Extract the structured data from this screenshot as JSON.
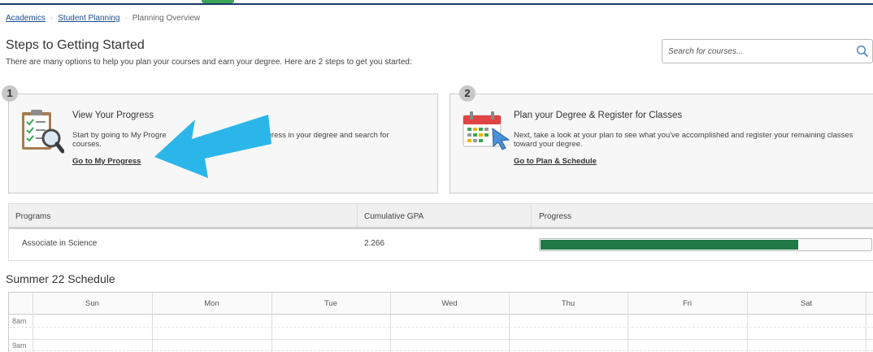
{
  "breadcrumb": {
    "items": [
      "Academics",
      "Student Planning",
      "Planning Overview"
    ]
  },
  "header": {
    "title": "Steps to Getting Started",
    "subtitle": "There are many options to help you plan your courses and earn your degree. Here are 2 steps to get you started:"
  },
  "search": {
    "placeholder": "Search for courses...",
    "icon": "search-icon"
  },
  "steps": [
    {
      "number": "1",
      "title": "View Your Progress",
      "desc_before": "Start by going to My Progre",
      "desc_after": "gress in your degree and search for",
      "desc_line2": "courses.",
      "link": "Go to My Progress",
      "icon": "clipboard-magnifier-icon"
    },
    {
      "number": "2",
      "title": "Plan your Degree & Register for Classes",
      "desc": "Next, take a look at your plan to see what you've accomplished and register your remaining classes toward your degree.",
      "link": "Go to Plan & Schedule",
      "icon": "calendar-pointer-icon"
    }
  ],
  "programs": {
    "columns": [
      "Programs",
      "Cumulative GPA",
      "Progress"
    ],
    "rows": [
      {
        "program": "Associate in Science",
        "gpa": "2.266",
        "progress": 0.78
      }
    ]
  },
  "schedule": {
    "title": "Summer 22 Schedule",
    "days": [
      "Sun",
      "Mon",
      "Tue",
      "Wed",
      "Thu",
      "Fri",
      "Sat"
    ],
    "times": [
      "8am",
      "9am"
    ]
  },
  "colors": {
    "accent_arrow": "#2bb6ea",
    "progress_fill": "#1f7a47",
    "top_line": "#1b3a6b"
  }
}
